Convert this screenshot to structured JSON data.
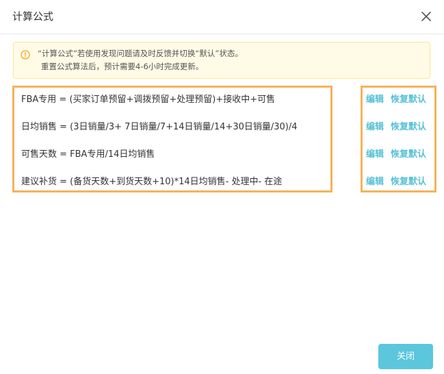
{
  "dialog": {
    "title": "计算公式",
    "close_icon": "close-icon"
  },
  "notice": {
    "icon": "warning-icon",
    "line1": "“计算公式”若使用发现问题请及时反馈并切换“默认”状态。",
    "line2": "重置公式算法后，预计需要4-6小时完成更新。"
  },
  "formulas": [
    {
      "text": "FBA专用 = (买家订单预留+调拨预留+处理预留)+接收中+可售"
    },
    {
      "text": "日均销售 = (3日销量/3+ 7日销量/7+14日销量/14+30日销量/30)/4"
    },
    {
      "text": "可售天数 = FBA专用/14日均销售"
    },
    {
      "text": "建议补货 = (备货天数+到货天数+10)*14日均销售- 处理中- 在途"
    }
  ],
  "actions": [
    {
      "edit": "编辑",
      "reset": "恢复默认"
    },
    {
      "edit": "编辑",
      "reset": "恢复默认"
    },
    {
      "edit": "编辑",
      "reset": "恢复默认"
    },
    {
      "edit": "编辑",
      "reset": "恢复默认"
    }
  ],
  "footer": {
    "close_label": "关闭"
  },
  "colors": {
    "accent": "#5bc6dc",
    "link": "#56c1d8",
    "highlight_border": "#f5b35a",
    "notice_bg": "#fffbe6",
    "notice_border": "#ffe58f",
    "warning_icon": "#f5a623"
  }
}
